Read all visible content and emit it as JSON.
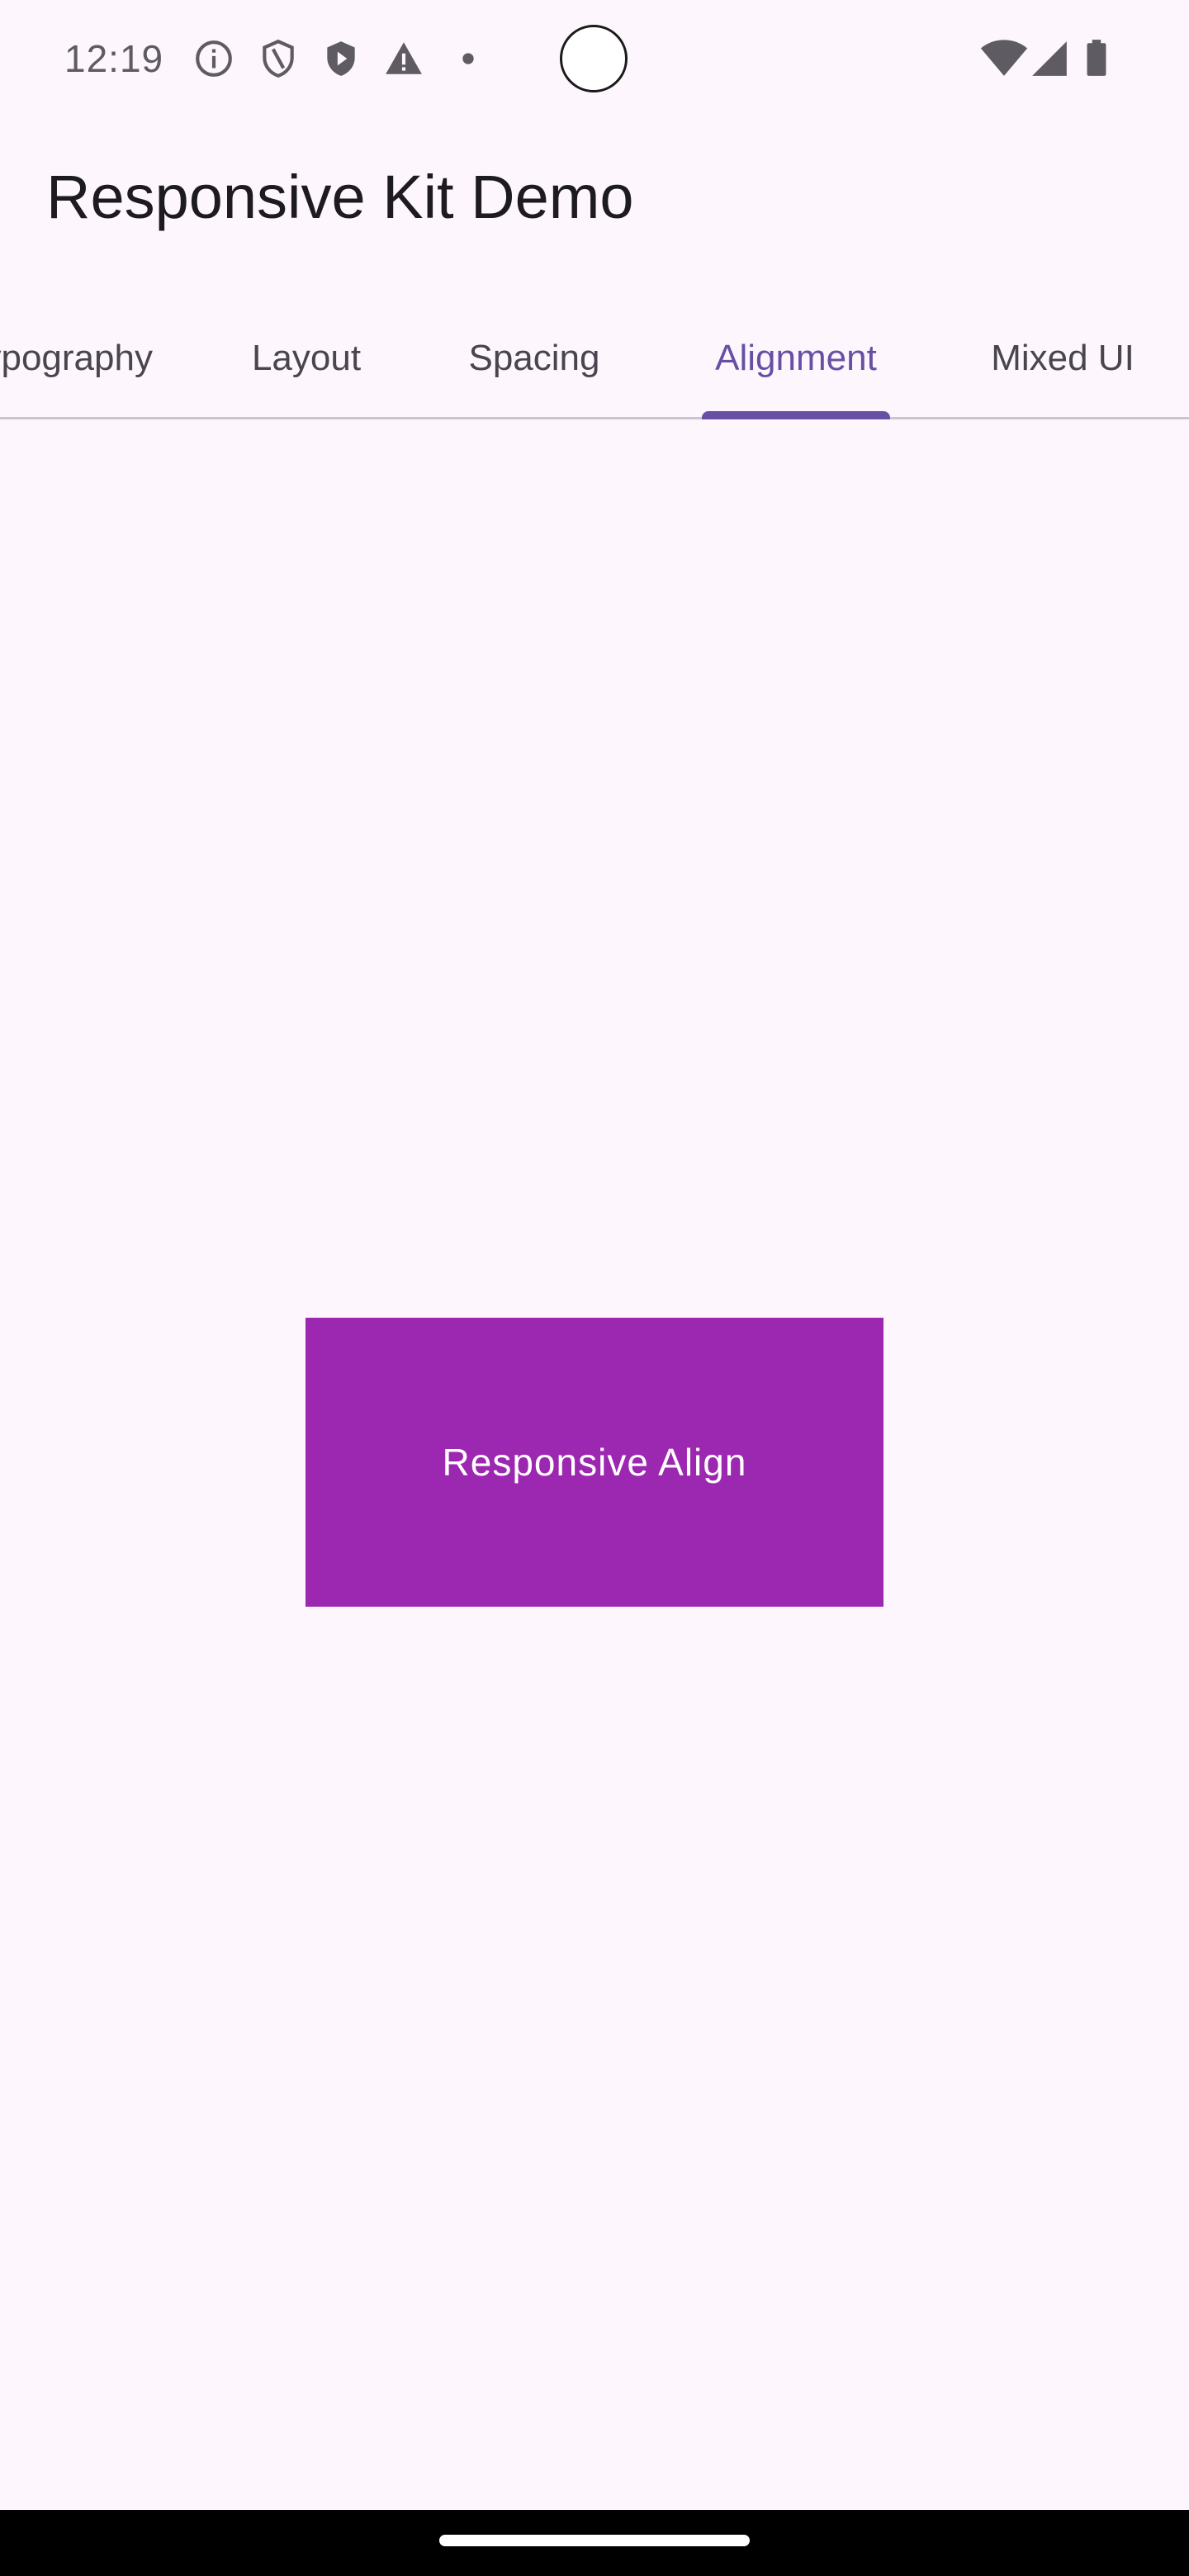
{
  "status_bar": {
    "time": "12:19",
    "left_icons": [
      "info-icon",
      "shield-outline-icon",
      "shield-play-icon",
      "warning-icon",
      "dot-icon"
    ],
    "right_icons": [
      "wifi-icon",
      "signal-icon",
      "battery-icon"
    ],
    "icon_color": "#5f5b63"
  },
  "app_bar": {
    "title": "Responsive Kit Demo"
  },
  "tabs": {
    "items": [
      {
        "label": "Typography",
        "active": false
      },
      {
        "label": "Layout",
        "active": false
      },
      {
        "label": "Spacing",
        "active": false
      },
      {
        "label": "Alignment",
        "active": true
      },
      {
        "label": "Mixed UI",
        "active": false
      }
    ],
    "active_color": "#6750a4",
    "inactive_color": "#49454f"
  },
  "content": {
    "box_label": "Responsive Align",
    "box_color": "#9c27b0"
  },
  "colors": {
    "background": "#fdf6fd"
  }
}
